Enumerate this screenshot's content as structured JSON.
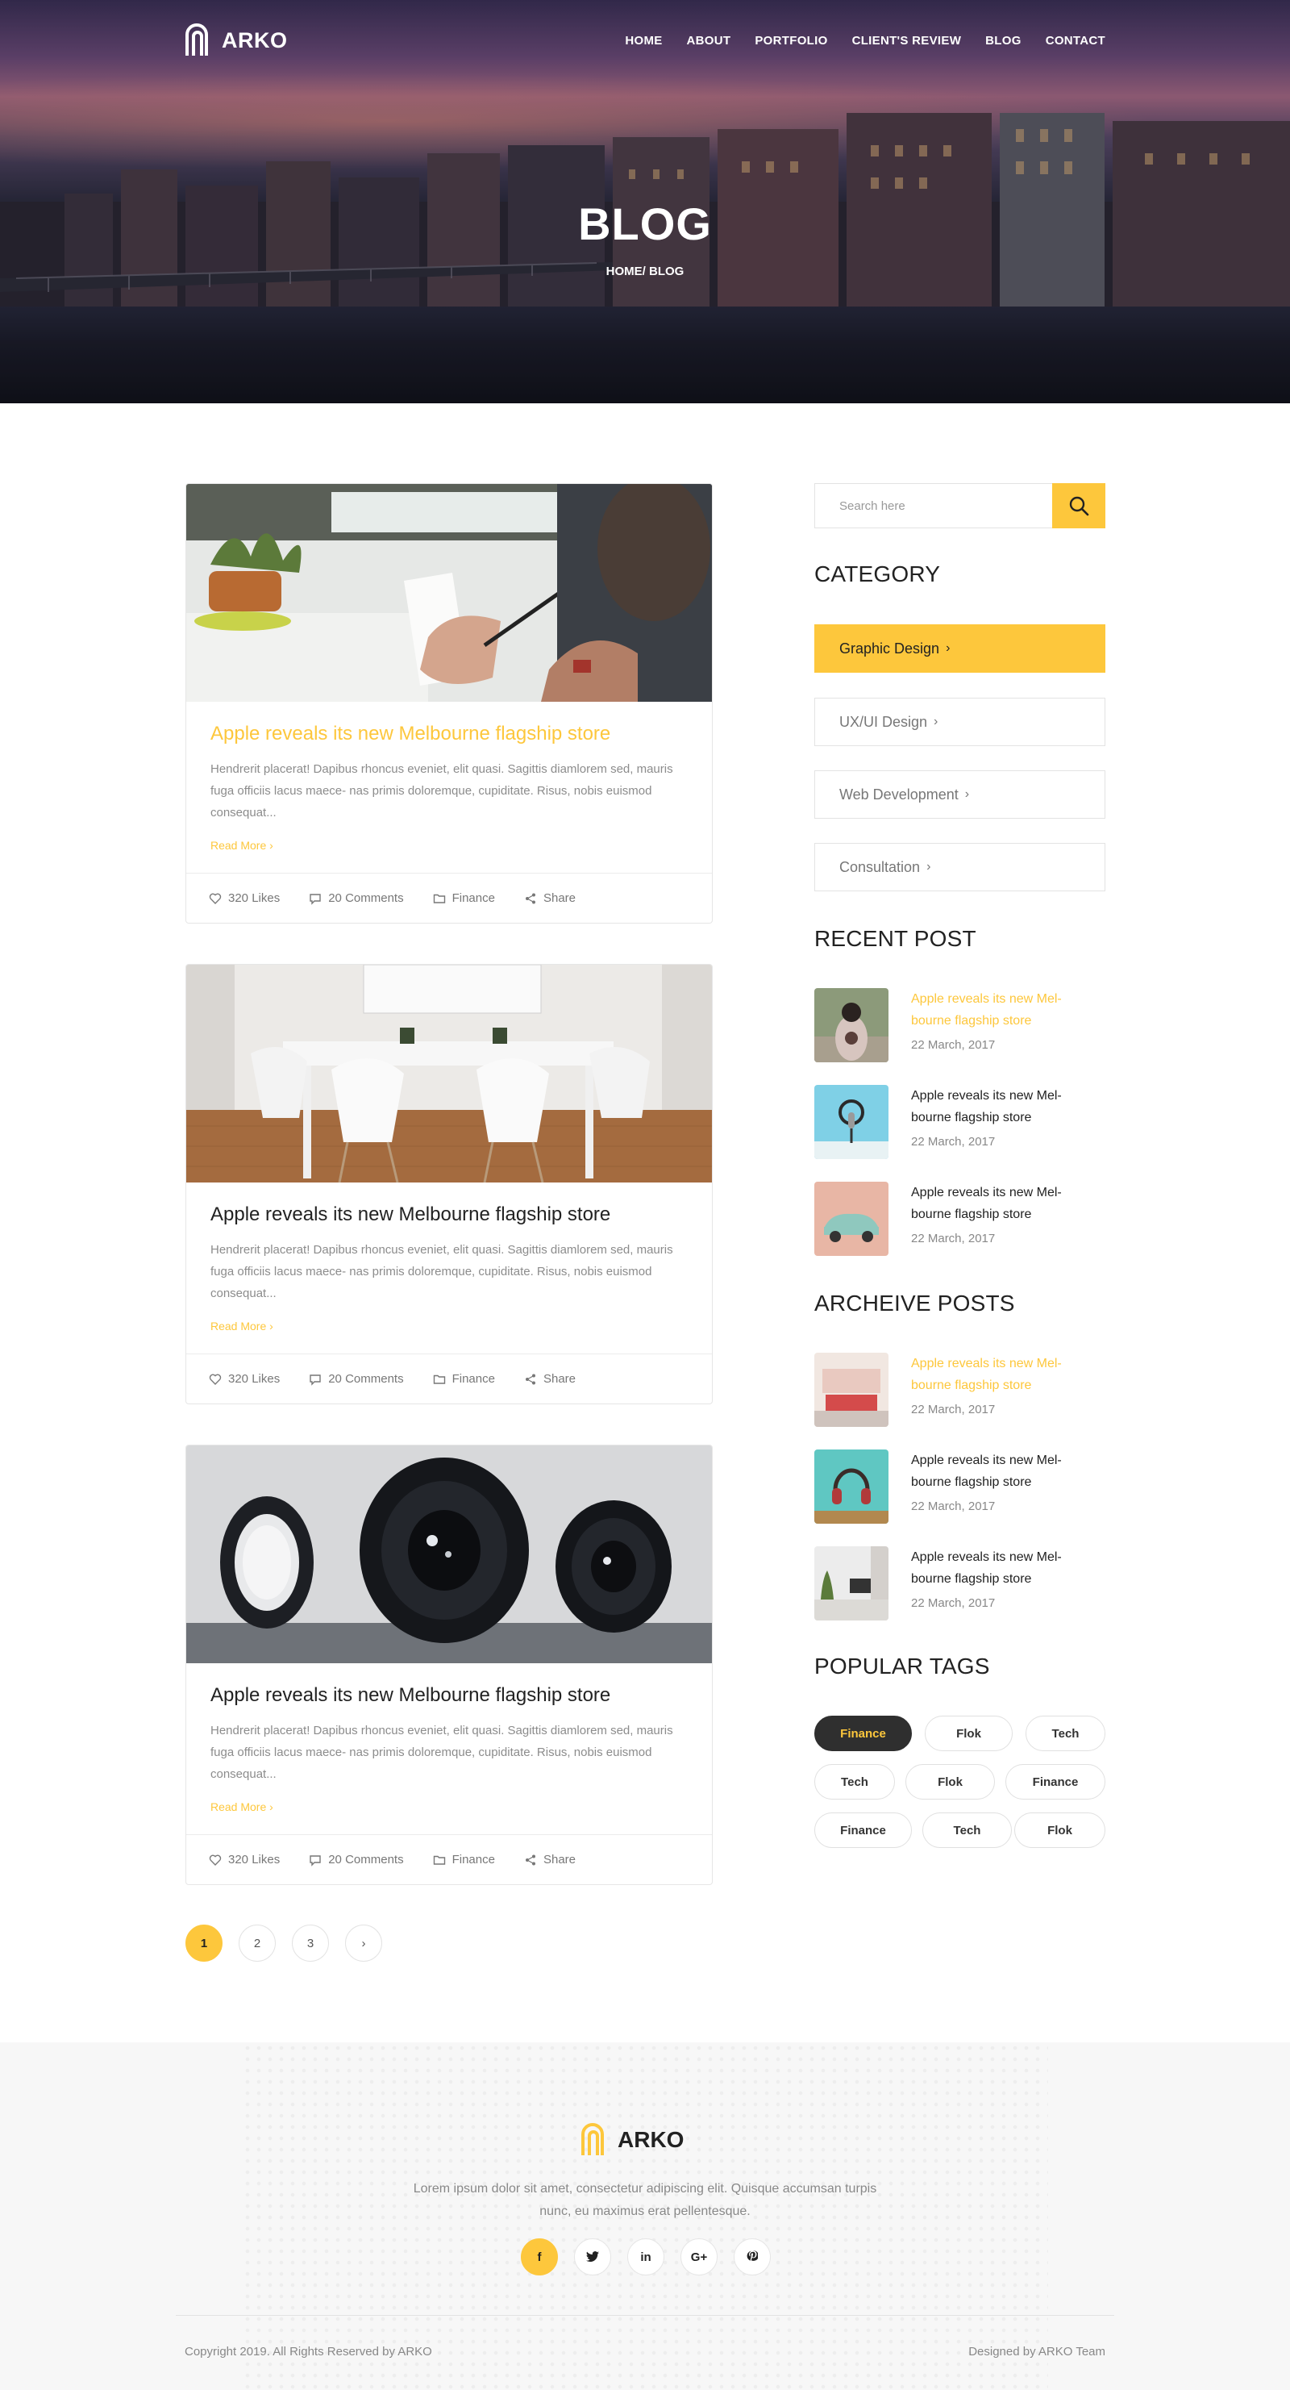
{
  "brand": {
    "name": "ARKO",
    "accent": "#fdc73c",
    "dark": "#2f2f2f"
  },
  "nav": {
    "items": [
      "HOME",
      "ABOUT",
      "PORTFOLIO",
      "CLIENT'S REVIEW",
      "BLOG",
      "CONTACT"
    ]
  },
  "hero": {
    "title": "BLOG",
    "breadcrumb": "HOME/ BLOG"
  },
  "posts": [
    {
      "title": "Apple reveals its new Melbourne flagship store",
      "excerpt": "Hendrerit placerat! Dapibus rhoncus eveniet, elit quasi. Sagittis diamlorem sed, mauris fuga officiis lacus maece- nas primis doloremque, cupiditate. Risus, nobis euismod consequat...",
      "read_more": "Read More",
      "likes": "320 Likes",
      "comments": "20 Comments",
      "category": "Finance",
      "share": "Share",
      "image": "desk-writing-photo"
    },
    {
      "title": "Apple reveals its new Melbourne flagship store",
      "excerpt": "Hendrerit placerat! Dapibus rhoncus eveniet, elit quasi. Sagittis diamlorem sed, mauris fuga officiis lacus maece- nas primis doloremque, cupiditate. Risus, nobis euismod consequat...",
      "read_more": "Read More",
      "likes": "320 Likes",
      "comments": "20 Comments",
      "category": "Finance",
      "share": "Share",
      "image": "meeting-table-photo"
    },
    {
      "title": "Apple reveals its new Melbourne flagship store",
      "excerpt": "Hendrerit placerat! Dapibus rhoncus eveniet, elit quasi. Sagittis diamlorem sed, mauris fuga officiis lacus maece- nas primis doloremque, cupiditate. Risus, nobis euismod consequat...",
      "read_more": "Read More",
      "likes": "320 Likes",
      "comments": "20 Comments",
      "category": "Finance",
      "share": "Share",
      "image": "camera-lenses-photo"
    }
  ],
  "pagination": {
    "pages": [
      "1",
      "2",
      "3"
    ],
    "current": "1",
    "next": "›"
  },
  "sidebar": {
    "search_placeholder": "Search here",
    "category_heading": "CATEGORY",
    "categories": [
      "Graphic Design",
      "UX/UI Design",
      "Web Development",
      "Consultation"
    ],
    "recent_heading": "RECENT POST",
    "recent": [
      {
        "title": "Apple reveals its new Mel- bourne flagship store",
        "date": "22 March, 2017"
      },
      {
        "title": "Apple reveals its new Mel- bourne flagship store",
        "date": "22 March, 2017"
      },
      {
        "title": "Apple reveals its new Mel- bourne flagship store",
        "date": "22 March, 2017"
      }
    ],
    "archive_heading": "ARCHEIVE POSTS",
    "archive": [
      {
        "title": "Apple reveals its new Mel- bourne flagship store",
        "date": "22 March, 2017"
      },
      {
        "title": "Apple reveals its new Mel- bourne flagship store",
        "date": "22 March, 2017"
      },
      {
        "title": "Apple reveals its new Mel- bourne flagship store",
        "date": "22 March, 2017"
      }
    ],
    "tags_heading": "POPULAR TAGS",
    "tags": [
      "Finance",
      "Flok",
      "Tech",
      "Tech",
      "Flok",
      "Finance",
      "Finance",
      "Tech",
      "Flok"
    ]
  },
  "footer": {
    "brand": "ARKO",
    "description": "Lorem ipsum dolor sit amet, consectetur adipiscing elit. Quisque accumsan turpis nunc, eu maximus erat pellentesque.",
    "social": [
      "f",
      "twitter-icon",
      "in",
      "G+",
      "pinterest-icon"
    ],
    "copyright": "Copyright 2019. All Rights Reserved by ARKO",
    "designed_by": "Designed by ARKO Team"
  }
}
